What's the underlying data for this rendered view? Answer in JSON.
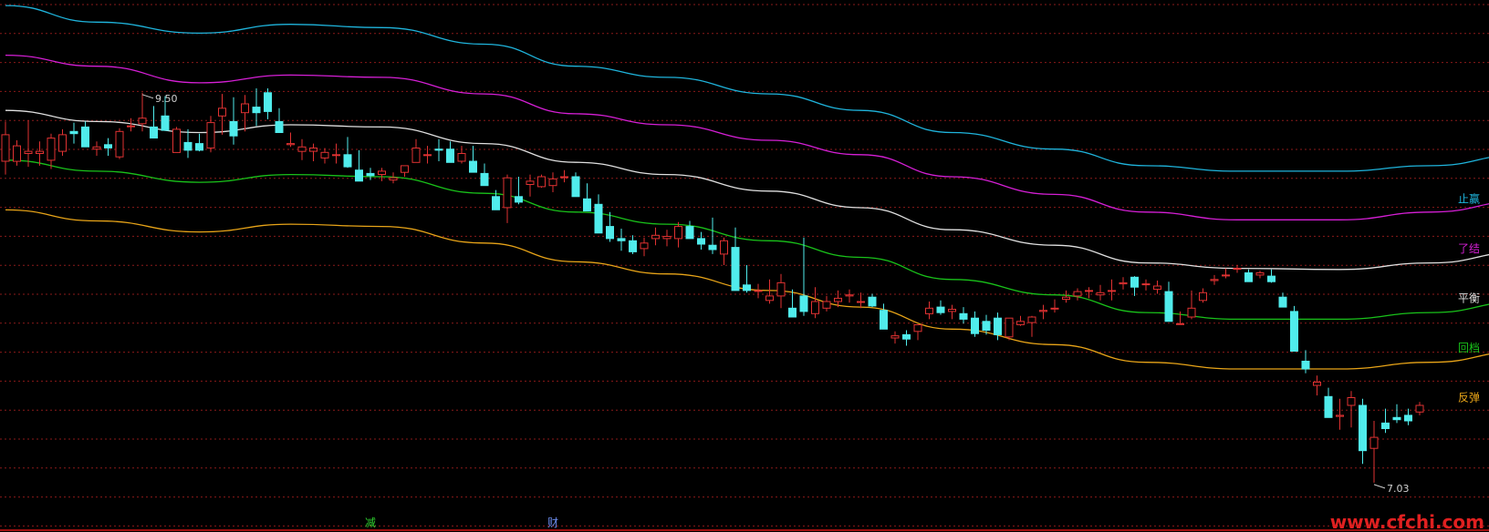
{
  "chart_data": {
    "type": "candlestick",
    "grid": "horizontal dashed",
    "ylim": [
      6.6,
      11.4
    ],
    "series": [
      {
        "name": "止赢",
        "color": "#1fb4dc",
        "x": [
          0,
          8,
          17,
          25,
          33,
          42,
          50,
          58,
          67,
          75,
          83,
          92,
          100,
          108,
          117,
          125,
          133,
          142,
          150,
          158,
          167,
          175,
          183,
          192,
          200
        ],
        "values": [
          11.35,
          11.2,
          11.1,
          11.18,
          11.15,
          11.0,
          10.8,
          10.7,
          10.55,
          10.4,
          10.2,
          10.05,
          9.9,
          9.85,
          9.85,
          9.9,
          10.0,
          10.05,
          10.1,
          10.0,
          10.05,
          10.12,
          10.12,
          10.0,
          9.6
        ]
      },
      {
        "name": "了结",
        "color": "#d61fd6",
        "x": [
          0,
          8,
          17,
          25,
          33,
          42,
          50,
          58,
          67,
          75,
          83,
          92,
          100,
          108,
          117,
          125,
          133,
          142,
          150,
          158,
          167,
          175,
          183,
          192,
          200
        ],
        "values": [
          10.9,
          10.8,
          10.65,
          10.72,
          10.7,
          10.55,
          10.37,
          10.27,
          10.13,
          10.0,
          9.8,
          9.64,
          9.48,
          9.41,
          9.41,
          9.48,
          9.58,
          9.62,
          9.67,
          9.58,
          9.62,
          9.67,
          9.67,
          9.57,
          9.15
        ]
      },
      {
        "name": "平衡",
        "color": "#e0e0e0",
        "x": [
          0,
          8,
          17,
          25,
          33,
          42,
          50,
          58,
          67,
          75,
          83,
          92,
          100,
          108,
          117,
          125,
          133,
          142,
          150,
          158,
          167,
          175,
          183,
          192,
          200
        ],
        "values": [
          10.4,
          10.3,
          10.2,
          10.27,
          10.25,
          10.1,
          9.93,
          9.82,
          9.67,
          9.52,
          9.32,
          9.18,
          9.02,
          8.97,
          8.96,
          9.02,
          9.12,
          9.17,
          9.21,
          9.12,
          9.17,
          9.21,
          9.21,
          9.11,
          8.7
        ]
      },
      {
        "name": "回档",
        "color": "#19c21a",
        "x": [
          0,
          8,
          17,
          25,
          33,
          42,
          50,
          58,
          67,
          75,
          83,
          92,
          100,
          108,
          117,
          125,
          133,
          142,
          150,
          158,
          167,
          175,
          183,
          192,
          200
        ],
        "values": [
          9.95,
          9.85,
          9.75,
          9.82,
          9.8,
          9.65,
          9.48,
          9.37,
          9.22,
          9.07,
          8.87,
          8.73,
          8.57,
          8.51,
          8.51,
          8.57,
          8.67,
          8.71,
          8.76,
          8.66,
          8.71,
          8.76,
          8.76,
          8.66,
          8.25
        ]
      },
      {
        "name": "反弹",
        "color": "#e8a418",
        "x": [
          0,
          8,
          17,
          25,
          33,
          42,
          50,
          58,
          67,
          75,
          83,
          92,
          100,
          108,
          117,
          125,
          133,
          142,
          150,
          158,
          167,
          175,
          183,
          192,
          200
        ],
        "values": [
          9.5,
          9.4,
          9.3,
          9.37,
          9.35,
          9.2,
          9.03,
          8.92,
          8.77,
          8.62,
          8.42,
          8.28,
          8.12,
          8.06,
          8.06,
          8.12,
          8.22,
          8.26,
          8.31,
          8.21,
          8.26,
          8.31,
          8.31,
          8.21,
          7.8
        ]
      }
    ],
    "candles_ohlc": [
      [
        9.94,
        10.3,
        9.82,
        10.18
      ],
      [
        9.94,
        10.13,
        9.9,
        10.08
      ],
      [
        10.01,
        10.31,
        9.89,
        10.03
      ],
      [
        10.01,
        10.12,
        9.9,
        10.03
      ],
      [
        9.95,
        10.19,
        9.87,
        10.15
      ],
      [
        10.03,
        10.23,
        9.99,
        10.18
      ],
      [
        10.21,
        10.29,
        10.1,
        10.19
      ],
      [
        10.25,
        10.3,
        10.12,
        10.07
      ],
      [
        10.05,
        10.12,
        9.99,
        10.07
      ],
      [
        10.09,
        10.15,
        9.99,
        10.06
      ],
      [
        9.98,
        10.24,
        9.96,
        10.21
      ],
      [
        10.26,
        10.33,
        10.21,
        10.26
      ],
      [
        10.28,
        10.56,
        10.21,
        10.33
      ],
      [
        10.25,
        10.44,
        10.2,
        10.15
      ],
      [
        10.35,
        10.53,
        10.22,
        10.22
      ],
      [
        10.02,
        10.25,
        10.03,
        10.23
      ],
      [
        10.11,
        10.23,
        9.97,
        10.04
      ],
      [
        10.1,
        10.19,
        10.03,
        10.04
      ],
      [
        10.06,
        10.35,
        10.02,
        10.29
      ],
      [
        10.35,
        10.55,
        10.18,
        10.42
      ],
      [
        10.3,
        10.52,
        10.09,
        10.17
      ],
      [
        10.38,
        10.54,
        10.21,
        10.46
      ],
      [
        10.43,
        10.6,
        10.26,
        10.38
      ],
      [
        10.56,
        10.6,
        10.32,
        10.39
      ],
      [
        10.3,
        10.42,
        10.2,
        10.2
      ],
      [
        10.09,
        10.2,
        10.07,
        10.1
      ],
      [
        10.03,
        10.14,
        9.95,
        10.07
      ],
      [
        10.03,
        10.1,
        9.94,
        10.06
      ],
      [
        9.97,
        10.06,
        9.92,
        10.02
      ],
      [
        10.0,
        10.1,
        9.92,
        10.0
      ],
      [
        10.0,
        10.16,
        9.88,
        9.89
      ],
      [
        9.86,
        10.04,
        9.76,
        9.76
      ],
      [
        9.83,
        9.88,
        9.77,
        9.81
      ],
      [
        9.82,
        9.88,
        9.76,
        9.85
      ],
      [
        9.77,
        9.84,
        9.74,
        9.79
      ],
      [
        9.84,
        9.9,
        9.8,
        9.9
      ],
      [
        9.93,
        10.14,
        9.96,
        10.06
      ],
      [
        10.0,
        10.08,
        9.92,
        10.0
      ],
      [
        10.05,
        10.14,
        9.94,
        10.04
      ],
      [
        10.05,
        10.12,
        9.93,
        9.93
      ],
      [
        9.94,
        10.08,
        9.92,
        10.01
      ],
      [
        9.94,
        10.08,
        9.84,
        9.84
      ],
      [
        9.83,
        9.92,
        9.74,
        9.72
      ],
      [
        9.62,
        9.68,
        9.5,
        9.5
      ],
      [
        9.52,
        9.82,
        9.38,
        9.79
      ],
      [
        9.62,
        9.8,
        9.55,
        9.57
      ],
      [
        9.73,
        9.82,
        9.62,
        9.76
      ],
      [
        9.71,
        9.82,
        9.7,
        9.8
      ],
      [
        9.72,
        9.84,
        9.66,
        9.78
      ],
      [
        9.8,
        9.86,
        9.75,
        9.8
      ],
      [
        9.8,
        9.84,
        9.71,
        9.62
      ],
      [
        9.6,
        9.74,
        9.5,
        9.49
      ],
      [
        9.55,
        9.64,
        9.3,
        9.29
      ],
      [
        9.35,
        9.48,
        9.21,
        9.24
      ],
      [
        9.24,
        9.33,
        9.13,
        9.22
      ],
      [
        9.22,
        9.27,
        9.1,
        9.12
      ],
      [
        9.15,
        9.25,
        9.08,
        9.2
      ],
      [
        9.24,
        9.34,
        9.18,
        9.27
      ],
      [
        9.24,
        9.32,
        9.17,
        9.26
      ],
      [
        9.24,
        9.39,
        9.16,
        9.35
      ],
      [
        9.35,
        9.4,
        9.24,
        9.24
      ],
      [
        9.24,
        9.3,
        9.14,
        9.19
      ],
      [
        9.18,
        9.43,
        9.1,
        9.14
      ],
      [
        9.1,
        9.25,
        9.0,
        9.22
      ],
      [
        9.16,
        9.34,
        9.08,
        8.77
      ],
      [
        8.82,
        9.0,
        8.75,
        8.77
      ],
      [
        8.77,
        8.83,
        8.7,
        8.77
      ],
      [
        8.68,
        8.87,
        8.65,
        8.72
      ],
      [
        8.72,
        8.92,
        8.61,
        8.84
      ],
      [
        8.61,
        8.78,
        8.59,
        8.53
      ],
      [
        8.72,
        9.25,
        8.54,
        8.58
      ],
      [
        8.56,
        8.8,
        8.52,
        8.67
      ],
      [
        8.61,
        8.72,
        8.58,
        8.67
      ],
      [
        8.67,
        8.77,
        8.62,
        8.7
      ],
      [
        8.72,
        8.78,
        8.66,
        8.73
      ],
      [
        8.67,
        8.75,
        8.61,
        8.67
      ],
      [
        8.71,
        8.74,
        8.62,
        8.63
      ],
      [
        8.59,
        8.65,
        8.42,
        8.42
      ],
      [
        8.34,
        8.4,
        8.29,
        8.36
      ],
      [
        8.37,
        8.41,
        8.27,
        8.33
      ],
      [
        8.4,
        8.46,
        8.32,
        8.46
      ],
      [
        8.56,
        8.67,
        8.51,
        8.61
      ],
      [
        8.62,
        8.68,
        8.55,
        8.57
      ],
      [
        8.58,
        8.64,
        8.51,
        8.6
      ],
      [
        8.56,
        8.62,
        8.47,
        8.51
      ],
      [
        8.52,
        8.58,
        8.35,
        8.38
      ],
      [
        8.49,
        8.55,
        8.37,
        8.41
      ],
      [
        8.52,
        8.57,
        8.32,
        8.37
      ],
      [
        8.35,
        8.52,
        8.32,
        8.52
      ],
      [
        8.46,
        8.54,
        8.45,
        8.49
      ],
      [
        8.48,
        8.54,
        8.35,
        8.53
      ],
      [
        8.58,
        8.64,
        8.51,
        8.59
      ],
      [
        8.61,
        8.69,
        8.57,
        8.61
      ],
      [
        8.69,
        8.77,
        8.66,
        8.71
      ],
      [
        8.72,
        8.79,
        8.68,
        8.76
      ],
      [
        8.77,
        8.8,
        8.7,
        8.77
      ],
      [
        8.73,
        8.82,
        8.68,
        8.75
      ],
      [
        8.77,
        8.87,
        8.68,
        8.77
      ],
      [
        8.83,
        8.89,
        8.78,
        8.84
      ],
      [
        8.89,
        8.9,
        8.72,
        8.8
      ],
      [
        8.83,
        8.87,
        8.77,
        8.83
      ],
      [
        8.78,
        8.86,
        8.74,
        8.81
      ],
      [
        8.76,
        8.85,
        8.65,
        8.49
      ],
      [
        8.47,
        8.58,
        8.47,
        8.47
      ],
      [
        8.53,
        8.77,
        8.51,
        8.61
      ],
      [
        8.68,
        8.79,
        8.66,
        8.75
      ],
      [
        8.86,
        8.91,
        8.82,
        8.87
      ],
      [
        8.91,
        8.97,
        8.88,
        8.91
      ],
      [
        8.97,
        9.0,
        8.93,
        8.97
      ],
      [
        8.93,
        8.96,
        8.85,
        8.85
      ],
      [
        8.91,
        8.95,
        8.88,
        8.93
      ],
      [
        8.9,
        8.96,
        8.84,
        8.85
      ],
      [
        8.71,
        8.75,
        8.62,
        8.62
      ],
      [
        8.58,
        8.63,
        8.22,
        8.22
      ],
      [
        8.13,
        8.23,
        8.02,
        8.06
      ],
      [
        7.91,
        8.0,
        7.82,
        7.94
      ],
      [
        7.81,
        7.89,
        7.66,
        7.62
      ],
      [
        7.63,
        7.79,
        7.51,
        7.64
      ],
      [
        7.73,
        7.86,
        7.53,
        7.8
      ],
      [
        7.73,
        7.79,
        7.2,
        7.32
      ],
      [
        7.34,
        7.59,
        7.03,
        7.44
      ],
      [
        7.57,
        7.7,
        7.48,
        7.52
      ],
      [
        7.62,
        7.74,
        7.57,
        7.6
      ],
      [
        7.64,
        7.7,
        7.55,
        7.59
      ],
      [
        7.67,
        7.76,
        7.64,
        7.73
      ]
    ],
    "annotations": [
      {
        "text": "9.50",
        "x_index": 12,
        "y": 10.56
      },
      {
        "text": "7.03",
        "x_index": 120,
        "y": 7.03
      }
    ],
    "bottom_markers": [
      {
        "text": "减",
        "x_index": 32,
        "color": "#2fd12f"
      },
      {
        "text": "财",
        "x_index": 48,
        "color": "#6d8df0"
      }
    ],
    "up_color": "#e03232",
    "down_color": "#50ecec",
    "grid_color": "#8a1a1a"
  },
  "watermark": {
    "text": "www.cfchi.com",
    "color": "#e02020"
  }
}
